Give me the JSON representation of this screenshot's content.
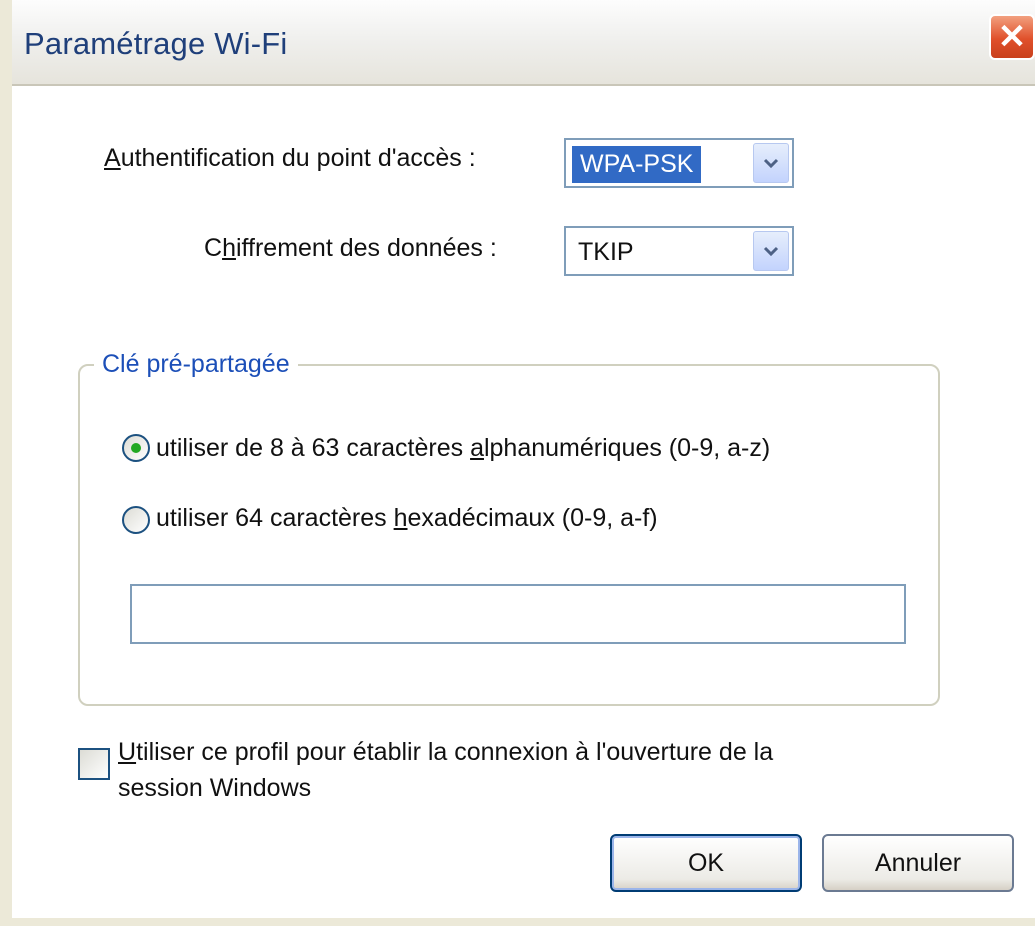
{
  "window": {
    "title": "Paramétrage Wi-Fi",
    "close_glyph": "✕"
  },
  "auth": {
    "label_first": "A",
    "label_rest": "uthentification du point d'accès :",
    "value": "WPA-PSK"
  },
  "encryption": {
    "label_pre": "C",
    "label_ul": "h",
    "label_rest": "iffrement des données :",
    "value": "TKIP"
  },
  "psk_group": {
    "legend": "Clé pré-partagée",
    "option1": {
      "pre": "utiliser de 8 à 63 caractères ",
      "ul": "a",
      "rest": "lphanumériques (0-9, a-z)",
      "selected": true
    },
    "option2": {
      "pre": "utiliser 64 caractères ",
      "ul": "h",
      "rest": "exadécimaux (0-9, a-f)",
      "selected": false
    },
    "key_value": ""
  },
  "logon_checkbox": {
    "ul": "U",
    "line1_rest": "tiliser ce profil pour établir la connexion à l'ouverture de la",
    "line2": "session Windows",
    "checked": false
  },
  "buttons": {
    "ok": "OK",
    "cancel": "Annuler"
  },
  "colors": {
    "accent": "#316ac5",
    "legend": "#1c4fb8",
    "title": "#1f3f7a",
    "close": "#e0502b"
  },
  "icons": {
    "dropdown_arrow": "chevron-down-icon",
    "close": "close-icon"
  }
}
